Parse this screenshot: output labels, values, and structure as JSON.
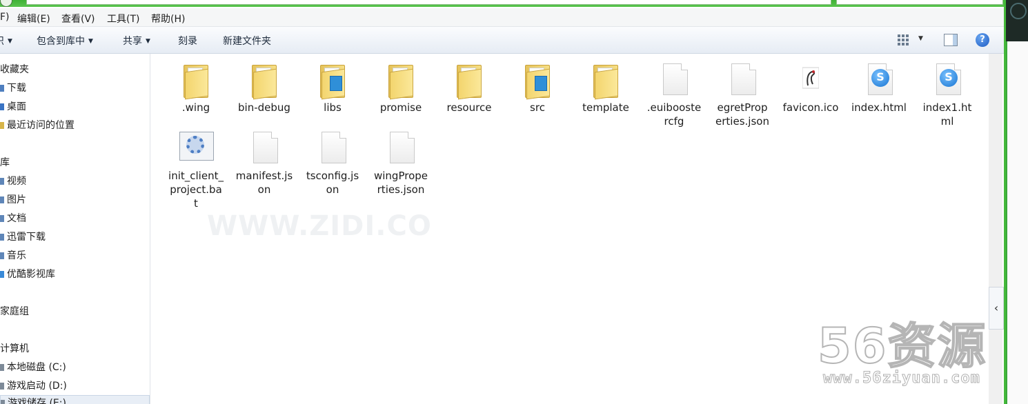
{
  "menubar": {
    "items": [
      "F)",
      "编辑(E)",
      "查看(V)",
      "工具(T)",
      "帮助(H)"
    ]
  },
  "toolbar": {
    "partial": "织",
    "include_library": "包含到库中",
    "share": "共享",
    "burn": "刻录",
    "new_folder": "新建文件夹"
  },
  "sidebar": {
    "items": [
      {
        "label": "收藏夹"
      },
      {
        "label": "下载"
      },
      {
        "label": "桌面"
      },
      {
        "label": "最近访问的位置"
      },
      {
        "label": "库"
      },
      {
        "label": "视频"
      },
      {
        "label": "图片"
      },
      {
        "label": "文档"
      },
      {
        "label": "迅雷下载"
      },
      {
        "label": "音乐"
      },
      {
        "label": "优酷影视库"
      },
      {
        "label": "家庭组"
      },
      {
        "label": "计算机"
      },
      {
        "label": "本地磁盘 (C:)"
      },
      {
        "label": "游戏启动 (D:)"
      },
      {
        "label": "游戏储存 (E:)"
      }
    ]
  },
  "files": [
    {
      "name": ".wing",
      "type": "folder"
    },
    {
      "name": "bin-debug",
      "type": "folder"
    },
    {
      "name": "libs",
      "type": "folder-badge"
    },
    {
      "name": "promise",
      "type": "folder"
    },
    {
      "name": "resource",
      "type": "folder"
    },
    {
      "name": "src",
      "type": "folder-badge"
    },
    {
      "name": "template",
      "type": "folder"
    },
    {
      "name": ".euibooste rcfg",
      "type": "file"
    },
    {
      "name": "egretProp erties.json",
      "type": "file"
    },
    {
      "name": "favicon.ico",
      "type": "ico"
    },
    {
      "name": "index.html",
      "type": "html"
    },
    {
      "name": "index1.ht ml",
      "type": "html"
    },
    {
      "name": "init_client_ project.ba t",
      "type": "bat"
    },
    {
      "name": "manifest.js on",
      "type": "file"
    },
    {
      "name": "tsconfig.js on",
      "type": "file"
    },
    {
      "name": "wingPrope rties.json",
      "type": "file"
    }
  ],
  "watermark": {
    "faint": "WWW.ZIDI.CO",
    "big": "56资源",
    "small": "www.56ziyuan.com"
  }
}
